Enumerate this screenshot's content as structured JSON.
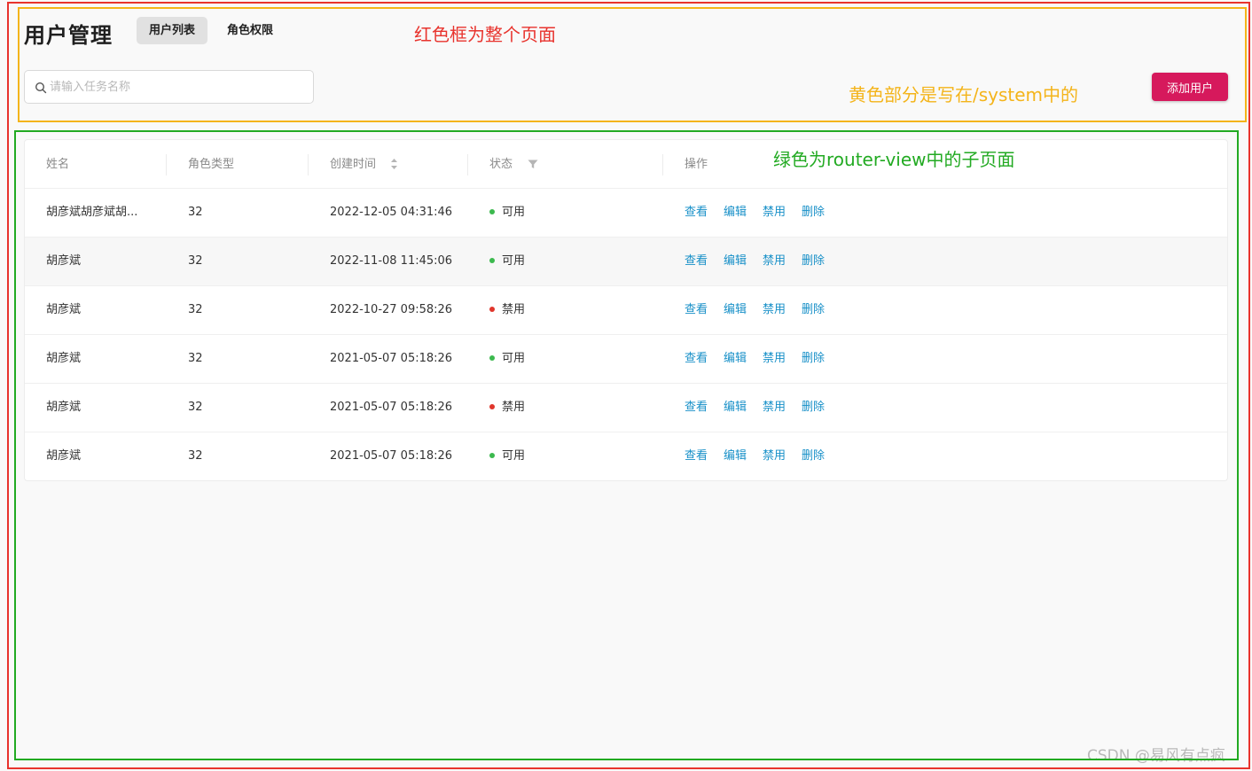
{
  "header": {
    "title": "用户管理",
    "tabs": [
      {
        "label": "用户列表",
        "active": true
      },
      {
        "label": "角色权限",
        "active": false
      }
    ],
    "search_placeholder": "请输入任务名称",
    "add_button_label": "添加用户"
  },
  "annotations": {
    "red": "红色框为整个页面",
    "yellow": "黄色部分是写在/system中的",
    "green": "绿色为router-view中的子页面"
  },
  "table": {
    "columns": [
      "姓名",
      "角色类型",
      "创建时间",
      "状态",
      "操作"
    ],
    "rows": [
      {
        "name": "胡彦斌胡彦斌胡...",
        "role": "32",
        "created": "2022-12-05 04:31:46",
        "status": "可用",
        "status_color": "#3cb94e"
      },
      {
        "name": "胡彦斌",
        "role": "32",
        "created": "2022-11-08 11:45:06",
        "status": "可用",
        "status_color": "#3cb94e"
      },
      {
        "name": "胡彦斌",
        "role": "32",
        "created": "2022-10-27 09:58:26",
        "status": "禁用",
        "status_color": "#e0352b"
      },
      {
        "name": "胡彦斌",
        "role": "32",
        "created": "2021-05-07 05:18:26",
        "status": "可用",
        "status_color": "#3cb94e"
      },
      {
        "name": "胡彦斌",
        "role": "32",
        "created": "2021-05-07 05:18:26",
        "status": "禁用",
        "status_color": "#e0352b"
      },
      {
        "name": "胡彦斌",
        "role": "32",
        "created": "2021-05-07 05:18:26",
        "status": "可用",
        "status_color": "#3cb94e"
      }
    ],
    "actions": [
      "查看",
      "编辑",
      "禁用",
      "删除"
    ]
  },
  "watermark": "CSDN @易风有点疯",
  "colors": {
    "accent": "#d6195c",
    "link": "#1890c8",
    "frame_red": "#e8332d",
    "frame_yellow": "#f4b41a",
    "frame_green": "#22aa22"
  }
}
